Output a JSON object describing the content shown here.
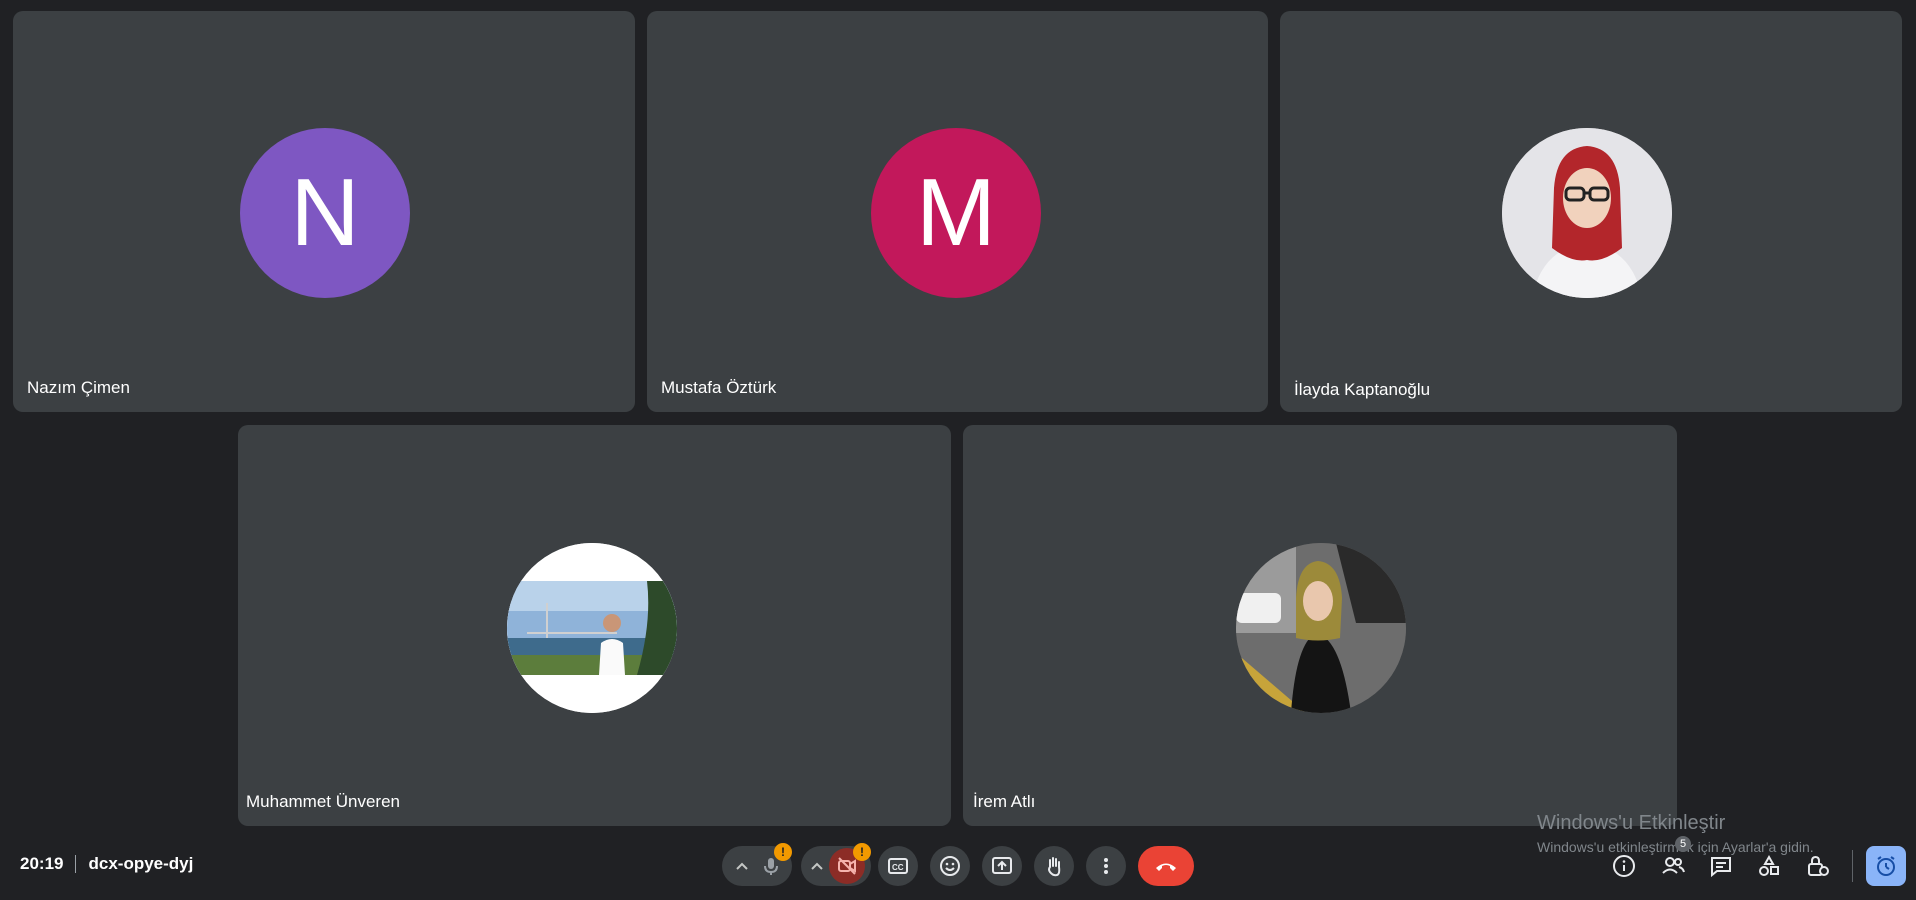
{
  "participants": [
    {
      "name": "Nazım Çimen",
      "initial": "N",
      "color": "#7e57c2",
      "avatar_type": "letter"
    },
    {
      "name": "Mustafa Öztürk",
      "initial": "M",
      "color": "#c2185b",
      "avatar_type": "letter"
    },
    {
      "name": "İlayda Kaptanoğlu",
      "avatar_type": "photo"
    },
    {
      "name": "Muhammet Ünveren",
      "avatar_type": "photo"
    },
    {
      "name": "İrem Atlı",
      "avatar_type": "photo"
    }
  ],
  "meeting": {
    "time": "20:19",
    "code": "dcx-opye-dyj"
  },
  "controls": {
    "mic_badge": "!",
    "camera_badge": "!",
    "participants_count": "5"
  },
  "icons": [
    "chevron-up-icon",
    "mic-off-icon",
    "camera-off-icon",
    "captions-icon",
    "emoji-icon",
    "present-screen-icon",
    "raise-hand-icon",
    "more-options-icon",
    "end-call-icon",
    "info-icon",
    "people-icon",
    "chat-icon",
    "activities-icon",
    "host-controls-icon",
    "timer-icon"
  ],
  "colors": {
    "background": "#202124",
    "tile": "#3c4043",
    "end_call": "#ea4335",
    "warning": "#f29900",
    "accent": "#8ab4f8"
  },
  "watermark": {
    "title": "Windows'u Etkinleştir",
    "subtitle": "Windows'u etkinleştirmek için Ayarlar'a gidin."
  }
}
